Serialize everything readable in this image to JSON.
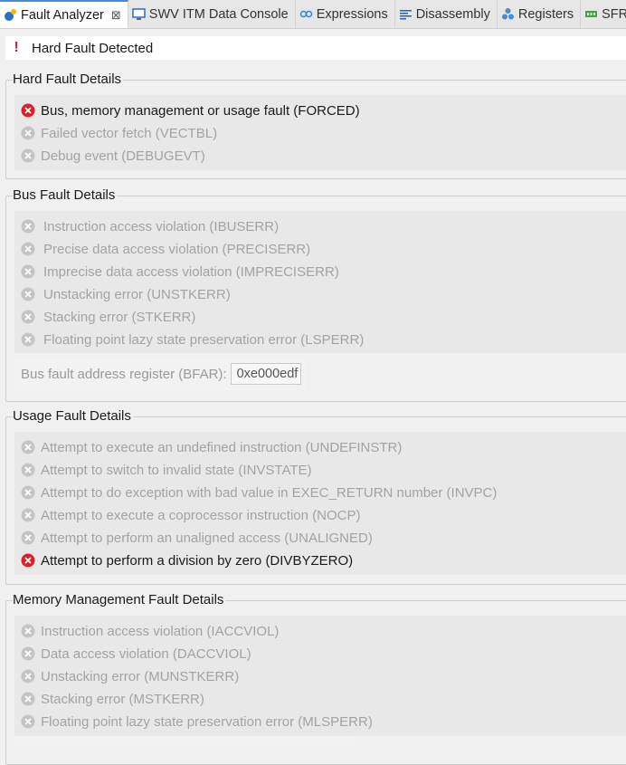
{
  "tabs": [
    {
      "label": "Fault Analyzer",
      "icon": "fault-analyzer-icon",
      "active": true,
      "closable": true
    },
    {
      "label": "SWV ITM Data Console",
      "icon": "console-icon"
    },
    {
      "label": "Expressions",
      "icon": "expressions-icon"
    },
    {
      "label": "Disassembly",
      "icon": "disassembly-icon"
    },
    {
      "label": "Registers",
      "icon": "registers-icon"
    },
    {
      "label": "SFRs",
      "icon": "sfrs-icon"
    }
  ],
  "banner": {
    "text": "Hard Fault Detected",
    "icon": "exclamation-icon"
  },
  "hard_fault": {
    "title": "Hard Fault Details",
    "items": [
      {
        "label": "Bus, memory management or usage fault (FORCED)",
        "active": true
      },
      {
        "label": "Failed vector fetch (VECTBL)",
        "active": false
      },
      {
        "label": "Debug event (DEBUGEVT)",
        "active": false
      }
    ]
  },
  "bus_fault": {
    "title": "Bus Fault Details",
    "items": [
      {
        "label": "Instruction access violation (IBUSERR)",
        "active": false
      },
      {
        "label": "Precise data access violation (PRECISERR)",
        "active": false
      },
      {
        "label": "Imprecise data access violation (IMPRECISERR)",
        "active": false
      },
      {
        "label": "Unstacking error (UNSTKERR)",
        "active": false
      },
      {
        "label": "Stacking error (STKERR)",
        "active": false
      },
      {
        "label": "Floating point lazy state preservation error (LSPERR)",
        "active": false
      }
    ],
    "bfar_label": "Bus fault address register (BFAR):",
    "bfar_value": "0xe000edf"
  },
  "usage_fault": {
    "title": "Usage Fault Details",
    "items": [
      {
        "label": "Attempt to execute an undefined instruction (UNDEFINSTR)",
        "active": false
      },
      {
        "label": "Attempt to switch to invalid state (INVSTATE)",
        "active": false
      },
      {
        "label": "Attempt to do exception with bad value in EXEC_RETURN number (INVPC)",
        "active": false
      },
      {
        "label": "Attempt to execute a coprocessor instruction (NOCP)",
        "active": false
      },
      {
        "label": "Attempt to perform an unaligned access (UNALIGNED)",
        "active": false
      },
      {
        "label": "Attempt to perform a division by zero (DIVBYZERO)",
        "active": true
      }
    ]
  },
  "mem_fault": {
    "title": "Memory Management Fault Details",
    "items": [
      {
        "label": "Instruction access violation (IACCVIOL)",
        "active": false
      },
      {
        "label": "Data access violation (DACCVIOL)",
        "active": false
      },
      {
        "label": "Unstacking error (MUNSTKERR)",
        "active": false
      },
      {
        "label": "Stacking error (MSTKERR)",
        "active": false
      },
      {
        "label": "Floating point lazy state preservation error (MLSPERR)",
        "active": false
      }
    ]
  },
  "colors": {
    "error_active": "#d9202b",
    "error_inactive": "#c4c4c4",
    "tab_accent": "#4b8bd4"
  }
}
